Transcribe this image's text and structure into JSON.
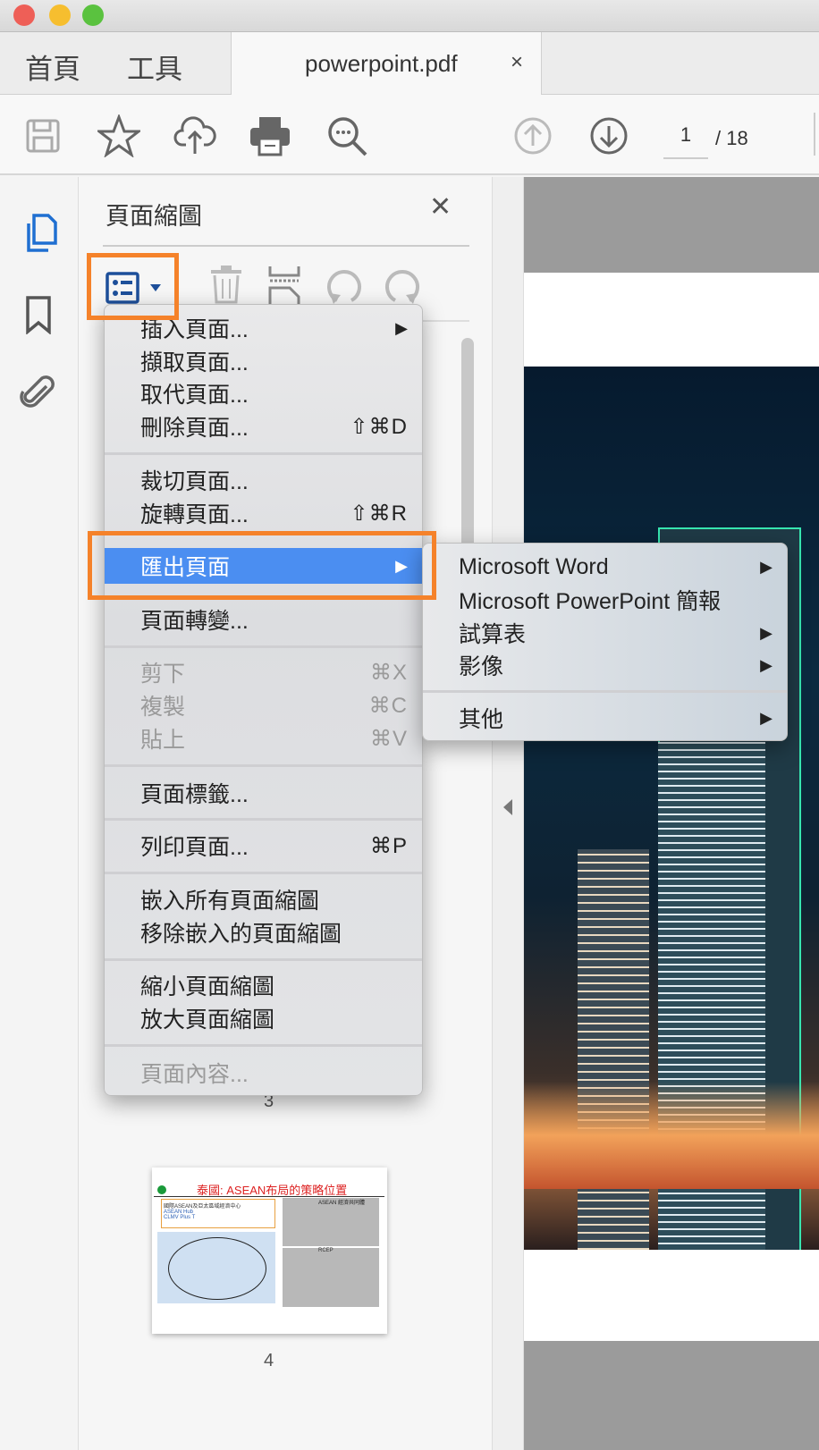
{
  "window": {
    "traffic_lights": {
      "close": "#ee5f57",
      "minimize": "#f6be2f",
      "zoom": "#5ac23f"
    }
  },
  "tabs": {
    "home": "首頁",
    "tools": "工具",
    "document": "powerpoint.pdf",
    "close": "×"
  },
  "toolbar": {
    "page_current": "1",
    "page_total": "/ 18"
  },
  "panel": {
    "title": "頁面縮圖",
    "close": "✕"
  },
  "menu": {
    "items": [
      {
        "label": "插入頁面...",
        "submenu": "▶"
      },
      {
        "label": "擷取頁面..."
      },
      {
        "label": "取代頁面..."
      },
      {
        "label": "刪除頁面...",
        "shortcut": "⇧⌘D"
      },
      {
        "label": "裁切頁面..."
      },
      {
        "label": "旋轉頁面...",
        "shortcut": "⇧⌘R"
      },
      {
        "label": "匯出頁面",
        "submenu": "▶"
      },
      {
        "label": "頁面轉變..."
      },
      {
        "label": "剪下",
        "shortcut": "⌘X"
      },
      {
        "label": "複製",
        "shortcut": "⌘C"
      },
      {
        "label": "貼上",
        "shortcut": "⌘V"
      },
      {
        "label": "頁面標籤..."
      },
      {
        "label": "列印頁面...",
        "shortcut": "⌘P"
      },
      {
        "label": "嵌入所有頁面縮圖"
      },
      {
        "label": "移除嵌入的頁面縮圖"
      },
      {
        "label": "縮小頁面縮圖"
      },
      {
        "label": "放大頁面縮圖"
      },
      {
        "label": "頁面內容..."
      }
    ],
    "highlight_color": "#4b8ef1"
  },
  "submenu": {
    "items": [
      {
        "label": "Microsoft Word",
        "submenu": "▶"
      },
      {
        "label": "Microsoft PowerPoint 簡報"
      },
      {
        "label": "試算表",
        "submenu": "▶"
      },
      {
        "label": "影像",
        "submenu": "▶"
      },
      {
        "label": "其他",
        "submenu": "▶"
      }
    ]
  },
  "thumbnails": {
    "page3": "3",
    "page4": "4",
    "slide4": {
      "title": "泰國: ASEAN布局的策略位置",
      "box": "國際ASEAN及亞太區域經濟中心",
      "bullets": [
        "ASEAN Hub",
        "CLMV Plus T"
      ],
      "right1": "ASEAN 經濟共同體",
      "right2": "RCEP"
    }
  },
  "accent": "#f5822a"
}
